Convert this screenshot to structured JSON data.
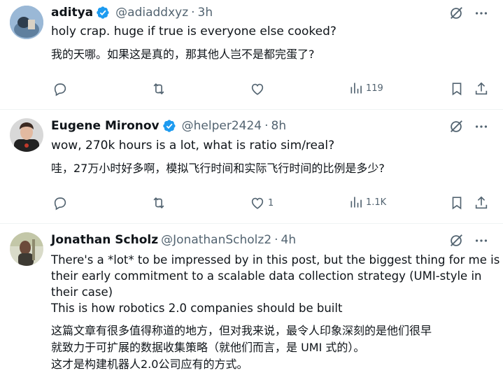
{
  "tweets": [
    {
      "name": "aditya",
      "handle": "@adiaddxyz",
      "dot": "·",
      "time": "3h",
      "text": "holy crap. huge if true is everyone else cooked?",
      "translation": "我的天哪。如果这是真的，那其他人岂不是都完蛋了?",
      "views": "119",
      "likes": ""
    },
    {
      "name": "Eugene Mironov",
      "handle": "@helper2424",
      "dot": "·",
      "time": "8h",
      "text": "wow, 270k hours is a lot, what is ratio sim/real?",
      "translation": "哇，27万小时好多啊，模拟飞行时间和实际飞行时间的比例是多少?",
      "views": "1.1K",
      "likes": "1"
    },
    {
      "name": "Jonathan Scholz",
      "handle": "@JonathanScholz2",
      "dot": "·",
      "time": "4h",
      "text_lines": [
        "There's a *lot* to be impressed by in this post, but the biggest thing for me is",
        "their early commitment to a scalable data collection strategy (UMI-style in",
        "their case)",
        "This is how robotics 2.0 companies should be built"
      ],
      "translation_lines": [
        "这篇文章有很多值得称道的地方，但对我来说，最令人印象深刻的是他们很早",
        "就致力于可扩展的数据收集策略（就他们而言，是 UMI 式的）。",
        "这才是构建机器人2.0公司应有的方式。"
      ]
    }
  ],
  "colors": {
    "accent": "#1d9bf0",
    "secondary": "#536471",
    "text": "#0f1419"
  },
  "icons": [
    "grok-icon",
    "more-icon",
    "reply-icon",
    "retweet-icon",
    "like-icon",
    "views-icon",
    "bookmark-icon",
    "share-icon",
    "verified-badge-icon"
  ]
}
